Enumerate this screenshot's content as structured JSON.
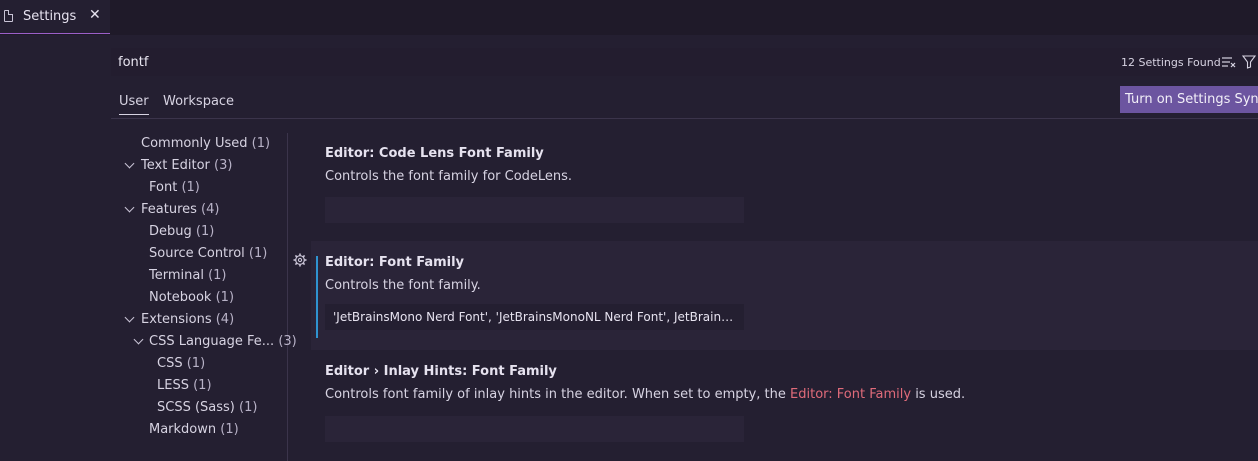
{
  "tab": {
    "label": "Settings",
    "close": "✕"
  },
  "search": {
    "value": "fontf",
    "found": "12 Settings Found"
  },
  "scopes": {
    "user": "User",
    "workspace": "Workspace",
    "sync_button": "Turn on Settings Sync"
  },
  "toc": [
    {
      "label": "Commonly Used",
      "count": "(1)"
    },
    {
      "label": "Text Editor",
      "count": "(3)"
    },
    {
      "label": "Font",
      "count": "(1)"
    },
    {
      "label": "Features",
      "count": "(4)"
    },
    {
      "label": "Debug",
      "count": "(1)"
    },
    {
      "label": "Source Control",
      "count": "(1)"
    },
    {
      "label": "Terminal",
      "count": "(1)"
    },
    {
      "label": "Notebook",
      "count": "(1)"
    },
    {
      "label": "Extensions",
      "count": "(4)"
    },
    {
      "label": "CSS Language Fe...",
      "count": "(3)"
    },
    {
      "label": "CSS",
      "count": "(1)"
    },
    {
      "label": "LESS",
      "count": "(1)"
    },
    {
      "label": "SCSS (Sass)",
      "count": "(1)"
    },
    {
      "label": "Markdown",
      "count": "(1)"
    }
  ],
  "settings": [
    {
      "title": "Editor: Code Lens Font Family",
      "description": "Controls the font family for CodeLens.",
      "value": ""
    },
    {
      "title": "Editor: Font Family",
      "description": "Controls the font family.",
      "value": "'JetBrainsMono Nerd Font', 'JetBrainsMonoNL Nerd Font', JetBrains Mono, monospace"
    },
    {
      "title": "Editor › Inlay Hints: Font Family",
      "description_pre": "Controls font family of inlay hints in the editor. When set to empty, the ",
      "description_link": "Editor: Font Family",
      "description_post": " is used.",
      "value": ""
    }
  ],
  "colors": {
    "accent": "#6c55a0",
    "focus": "#2f93d0",
    "link": "#e06b7a"
  }
}
